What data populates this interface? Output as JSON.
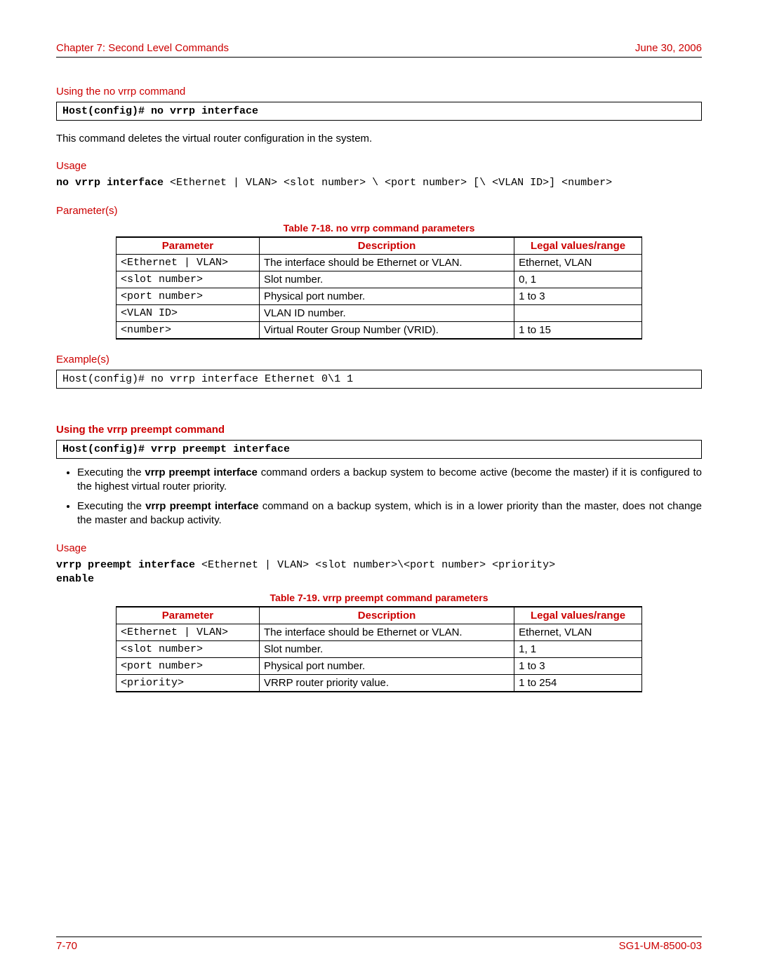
{
  "header": {
    "chapter": "Chapter 7: Second Level Commands",
    "date": "June 30, 2006"
  },
  "footer": {
    "page": "7-70",
    "docid": "SG1-UM-8500-03"
  },
  "sec1": {
    "title": "Using the no vrrp command",
    "cmd": "Host(config)# no vrrp interface",
    "desc": "This command deletes the virtual router configuration in the system.",
    "usage_label": "Usage",
    "usage_bold": "no vrrp interface ",
    "usage_rest": "<Ethernet | VLAN> <slot number> \\ <port number> [\\ <VLAN ID>] <number>",
    "params_label": "Parameter(s)",
    "table_caption": "Table 7-18. no vrrp command parameters",
    "th1": "Parameter",
    "th2": "Description",
    "th3": "Legal values/range",
    "rows": [
      {
        "p": "<Ethernet | VLAN>",
        "d": "The interface should be Ethernet or VLAN.",
        "l": "Ethernet, VLAN"
      },
      {
        "p": "<slot number>",
        "d": "Slot number.",
        "l": "0, 1"
      },
      {
        "p": "<port number>",
        "d": "Physical port number.",
        "l": "1 to 3"
      },
      {
        "p": "<VLAN ID>",
        "d": "VLAN ID number.",
        "l": ""
      },
      {
        "p": "<number>",
        "d": "Virtual Router Group Number (VRID).",
        "l": "1 to 15"
      }
    ],
    "examples_label": "Example(s)",
    "example": "Host(config)# no vrrp interface Ethernet 0\\1 1"
  },
  "sec2": {
    "title": "Using the vrrp preempt command",
    "cmd": "Host(config)# vrrp preempt interface",
    "bullet1_pre": "Executing the ",
    "bullet_cmd": "vrrp preempt interface",
    "bullet1_post": " command orders a backup system to become active (become the master) if it is configured to the highest virtual router priority.",
    "bullet2_pre": "Executing the ",
    "bullet2_post": " command on a backup system, which is in a lower priority than the master, does not change the master and backup activity.",
    "usage_label": "Usage",
    "usage_bold1": "vrrp preempt interface ",
    "usage_mid": "<Ethernet | VLAN> <slot number>\\<port number> <priority> ",
    "usage_bold2": "enable",
    "table_caption": "Table 7-19. vrrp preempt command parameters",
    "th1": "Parameter",
    "th2": "Description",
    "th3": "Legal values/range",
    "rows": [
      {
        "p": "<Ethernet | VLAN>",
        "d": "The interface should be Ethernet or VLAN.",
        "l": "Ethernet, VLAN"
      },
      {
        "p": "<slot number>",
        "d": "Slot number.",
        "l": "1, 1"
      },
      {
        "p": "<port number>",
        "d": "Physical port number.",
        "l": "1 to 3"
      },
      {
        "p": "<priority>",
        "d": "VRRP router priority value.",
        "l": "1 to 254"
      }
    ]
  }
}
